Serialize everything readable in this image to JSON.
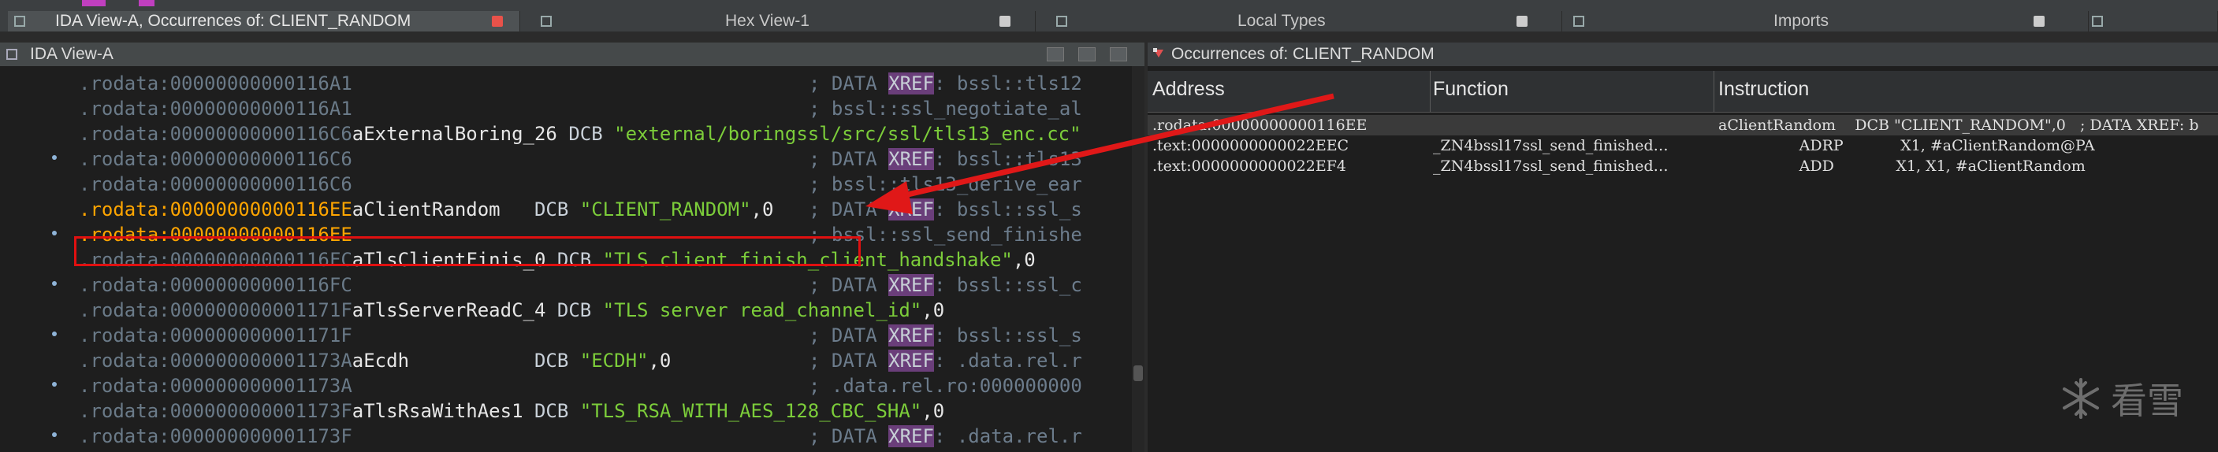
{
  "tabs": [
    {
      "label": "IDA View-A, Occurrences of: CLIENT_RANDOM",
      "active": true
    },
    {
      "label": "Hex View-1",
      "active": false
    },
    {
      "label": "Local Types",
      "active": false
    },
    {
      "label": "Imports",
      "active": false
    }
  ],
  "ida": {
    "title": "IDA View-A",
    "lines": [
      {
        "seg": ".rodata:00000000000116A1",
        "name": "",
        "kw": "",
        "str": "",
        "tail": "",
        "cm": "; DATA ",
        "xref": "XREF",
        "cm2": ": bssl::tls12",
        "bp": false
      },
      {
        "seg": ".rodata:00000000000116A1",
        "name": "",
        "kw": "",
        "str": "",
        "tail": "",
        "cm": "; bssl::ssl_negotiate_al",
        "xref": "",
        "cm2": "",
        "bp": false
      },
      {
        "seg": ".rodata:00000000000116C6",
        "name": "aExternalBoring_26",
        "kw": " DCB ",
        "str": "\"external/boringssl/src/ssl/tls13_enc.cc\"",
        "tail": "",
        "cm": "",
        "xref": "",
        "cm2": "",
        "bp": true
      },
      {
        "seg": ".rodata:00000000000116C6",
        "name": "",
        "kw": "",
        "str": "",
        "tail": "",
        "cm": "; DATA ",
        "xref": "XREF",
        "cm2": ": bssl::tls13",
        "bp": false
      },
      {
        "seg": ".rodata:00000000000116C6",
        "name": "",
        "kw": "",
        "str": "",
        "tail": "",
        "cm": "; bssl::tls13_derive_ear",
        "xref": "",
        "cm2": "",
        "bp": false
      },
      {
        "seg": ".rodata:00000000000116EE",
        "name": "aClientRandom",
        "kw": "   DCB ",
        "str": "\"CLIENT_RANDOM\"",
        "tail": ",0",
        "cm": "; DATA ",
        "xref": "XREF",
        "cm2": ": bssl::ssl_s",
        "bp": true,
        "hl": true
      },
      {
        "seg": ".rodata:00000000000116EE",
        "name": "",
        "kw": "",
        "str": "",
        "tail": "",
        "cm": "; bssl::ssl_send_finishe",
        "xref": "",
        "cm2": "",
        "bp": false,
        "hl2": true
      },
      {
        "seg": ".rodata:00000000000116FC",
        "name": "aTlsClientFinis_0",
        "kw": " DCB ",
        "str": "\"TLS client finish_client_handshake\"",
        "tail": ",0",
        "cm": "",
        "xref": "",
        "cm2": "",
        "bp": true
      },
      {
        "seg": ".rodata:00000000000116FC",
        "name": "",
        "kw": "",
        "str": "",
        "tail": "",
        "cm": "; DATA ",
        "xref": "XREF",
        "cm2": ": bssl::ssl_c",
        "bp": false
      },
      {
        "seg": ".rodata:000000000001171F",
        "name": "aTlsServerReadC_4",
        "kw": " DCB ",
        "str": "\"TLS server read_channel_id\"",
        "tail": ",0",
        "cm": "",
        "xref": "",
        "cm2": "",
        "bp": true
      },
      {
        "seg": ".rodata:000000000001171F",
        "name": "",
        "kw": "",
        "str": "",
        "tail": "",
        "cm": "; DATA ",
        "xref": "XREF",
        "cm2": ": bssl::ssl_s",
        "bp": false
      },
      {
        "seg": ".rodata:000000000001173A",
        "name": "aEcdh",
        "kw": "           DCB ",
        "str": "\"ECDH\"",
        "tail": ",0",
        "cm": "; DATA ",
        "xref": "XREF",
        "cm2": ": .data.rel.r",
        "bp": true
      },
      {
        "seg": ".rodata:000000000001173A",
        "name": "",
        "kw": "",
        "str": "",
        "tail": "",
        "cm": "; .data.rel.ro:000000000",
        "xref": "",
        "cm2": "",
        "bp": false
      },
      {
        "seg": ".rodata:000000000001173F",
        "name": "aTlsRsaWithAes1",
        "kw": " DCB ",
        "str": "\"TLS_RSA_WITH_AES_128_CBC_SHA\"",
        "tail": ",0",
        "cm": "",
        "xref": "",
        "cm2": "",
        "bp": true
      },
      {
        "seg": ".rodata:000000000001173F",
        "name": "",
        "kw": "",
        "str": "",
        "tail": "",
        "cm": "; DATA ",
        "xref": "XREF",
        "cm2": ": .data.rel.r",
        "bp": false
      }
    ]
  },
  "occurrences": {
    "title": "Occurrences of: CLIENT_RANDOM",
    "columns": [
      "Address",
      "Function",
      "Instruction"
    ],
    "rows": [
      {
        "address": ".rodata:00000000000116EE",
        "function": "",
        "instruction": "aClientRandom    DCB \"CLIENT_RANDOM\",0   ; DATA XREF: b",
        "selected": true
      },
      {
        "address": ".text:0000000000022EEC",
        "function": "_ZN4bssl17ssl_send_finished…",
        "instruction": "                 ADRP            X1, #aClientRandom@PA",
        "selected": false
      },
      {
        "address": ".text:0000000000022EF4",
        "function": "_ZN4bssl17ssl_send_finished…",
        "instruction": "                 ADD             X1, X1, #aClientRandom",
        "selected": false
      }
    ]
  },
  "watermark": {
    "text": "看雪",
    "icon": "snowflake-icon"
  }
}
